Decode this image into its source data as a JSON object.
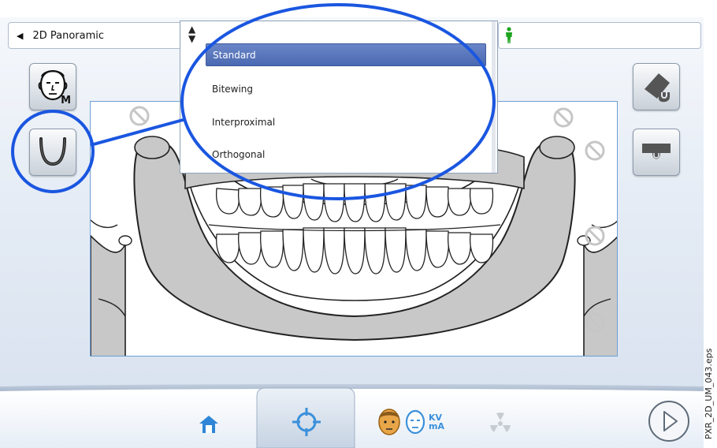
{
  "header": {
    "mode_label": "2D Panoramic",
    "back_icon": "triangle-left-icon",
    "patient_icon": "standing-person-icon",
    "patient_color": "#1fa51f"
  },
  "left_buttons": [
    {
      "name": "head-m-button",
      "icon": "patient-head-icon",
      "badge": "M"
    },
    {
      "name": "arch-button",
      "icon": "dental-arch-icon"
    }
  ],
  "right_buttons": [
    {
      "name": "eraser-button",
      "icon": "eraser-icon"
    },
    {
      "name": "tray-button",
      "icon": "bite-tray-icon"
    }
  ],
  "dropdown": {
    "sort_icon": "up-down-arrows-icon",
    "options": [
      "Standard",
      "Bitewing",
      "Interproximal",
      "Orthogonal"
    ],
    "selected": "Standard"
  },
  "footer": {
    "tabs": [
      {
        "name": "home-tab",
        "icon": "home-icon"
      },
      {
        "name": "positioning-tab",
        "icon": "crosshair-icon",
        "active": true
      },
      {
        "name": "parameters-tab",
        "icon": "head-kv-ma-icon",
        "kv": "KV",
        "ma": "mA"
      },
      {
        "name": "exposure-tab",
        "icon": "radiation-icon"
      }
    ],
    "play_icon": "play-icon"
  },
  "caption": "PXR_2D_UM_043.eps",
  "colors": {
    "accent": "#1a56e0",
    "selected": "#5874bd",
    "bone": "#c8c8c8",
    "frame": "#6d9fd3"
  }
}
